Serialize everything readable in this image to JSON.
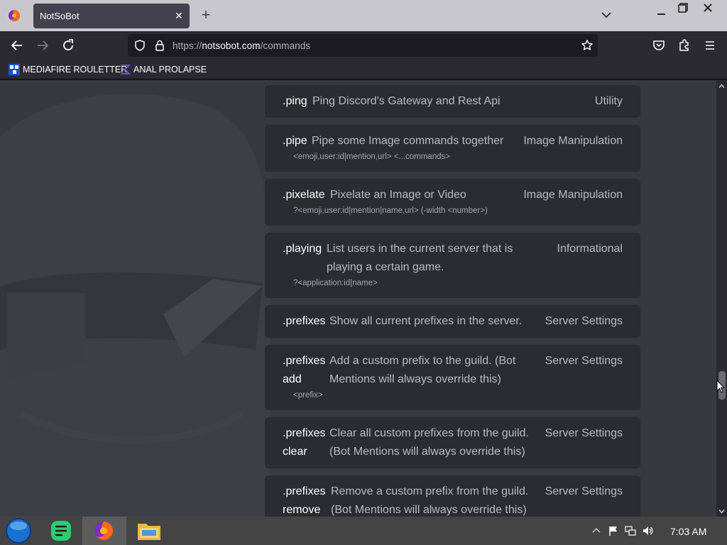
{
  "tab": {
    "title": "NotSoBot",
    "close": "✕"
  },
  "toolbar": {
    "new_tab": "+"
  },
  "address_bar": {
    "scheme": "https://",
    "host": "notsobot.com",
    "path": "/commands"
  },
  "bookmarks": [
    {
      "label": "MEDIAFIRE ROULETTER",
      "icon": "mediafire-icon"
    },
    {
      "label": "ANAL PROLAPSE",
      "icon": "sigma-icon"
    }
  ],
  "commands": [
    {
      "name": ".ping",
      "description": "Ping Discord's Gateway and Rest Api",
      "category": "Utility",
      "usage": ""
    },
    {
      "name": ".pipe",
      "description": "Pipe some Image commands together",
      "category": "Image Manipulation",
      "usage": "<emoji,user:id|mention,url> <...commands>"
    },
    {
      "name": ".pixelate",
      "description": "Pixelate an Image or Video",
      "category": "Image Manipulation",
      "usage": "?<emoji,user:id|mention|name,url> (-width <number>)"
    },
    {
      "name": ".playing",
      "description": "List users in the current server that is playing a certain game.",
      "category": "Informational",
      "usage": "?<application:id|name>"
    },
    {
      "name": ".prefixes",
      "description": "Show all current prefixes in the server.",
      "category": "Server Settings",
      "usage": ""
    },
    {
      "name": ".prefixes add",
      "description": "Add a custom prefix to the guild. (Bot Mentions will always override this)",
      "category": "Server Settings",
      "usage": "<prefix>"
    },
    {
      "name": ".prefixes clear",
      "description": "Clear all custom prefixes from the guild. (Bot Mentions will always override this)",
      "category": "Server Settings",
      "usage": ""
    },
    {
      "name": ".prefixes remove",
      "description": "Remove a custom prefix from the guild. (Bot Mentions will always override this)",
      "category": "Server Settings",
      "usage": ""
    }
  ],
  "taskbar": {
    "clock": "7:03 AM"
  }
}
